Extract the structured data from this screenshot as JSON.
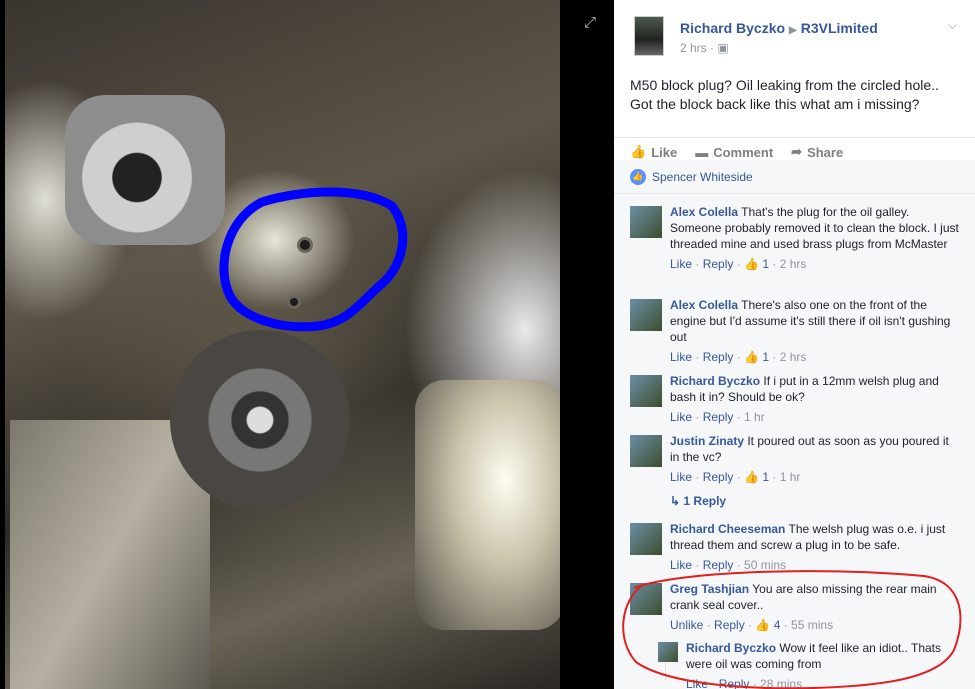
{
  "viewer": {
    "expand_icon": "expand-icon"
  },
  "post": {
    "author": "Richard Byczko",
    "group": "R3VLimited",
    "time": "2 hrs",
    "text_line1": "M50 block plug? Oil leaking from the circled hole..",
    "text_line2": "Got the block back like this what am i missing?",
    "actions": {
      "like": "Like",
      "comment": "Comment",
      "share": "Share"
    },
    "likers": "Spencer Whiteside"
  },
  "comments": [
    {
      "author": "Alex Colella",
      "text": " That's the plug for the oil galley. Someone probably removed it to clean the block. I just threaded mine and used brass plugs from McMaster",
      "like": "Like",
      "reply": "Reply",
      "likes": "1",
      "time": "2 hrs"
    },
    {
      "author": "Alex Colella",
      "text": " There's also one on the front of the engine but I'd assume it's still there if oil isn't gushing out",
      "like": "Like",
      "reply": "Reply",
      "likes": "1",
      "time": "2 hrs"
    },
    {
      "author": "Richard Byczko",
      "text": " If i put in a 12mm welsh plug and bash it in? Should be ok?",
      "like": "Like",
      "reply": "Reply",
      "time": "1 hr"
    },
    {
      "author": "Justin Zinaty",
      "text": " It poured out as soon as you poured it in the vc?",
      "like": "Like",
      "reply": "Reply",
      "likes": "1",
      "time": "1 hr"
    },
    {
      "author": "Richard Cheeseman",
      "text": " The welsh plug was o.e. i just thread them and screw a plug in to be safe.",
      "like": "Like",
      "reply": "Reply",
      "time": "50 mins"
    },
    {
      "author": "Greg Tashjian",
      "text": " You are also missing the rear main crank seal cover..",
      "like": "Unlike",
      "reply": "Reply",
      "likes": "4",
      "time": "55 mins"
    },
    {
      "author": "Richard Byczko",
      "text": " Wow it feel like an idiot.. Thats were oil was coming from",
      "like": "Like",
      "reply": "Reply",
      "time": "28 mins"
    }
  ],
  "replies_link": "1 Reply",
  "colors": {
    "link": "#365899",
    "annotation_blue": "#0000ff",
    "annotation_red": "#e0201e"
  }
}
